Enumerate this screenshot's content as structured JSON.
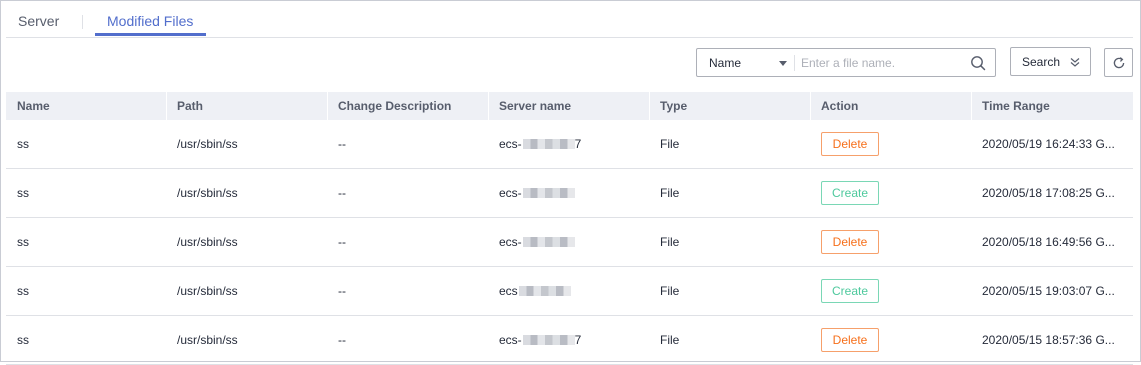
{
  "tabs": [
    {
      "label": "Server",
      "active": false
    },
    {
      "label": "Modified Files",
      "active": true
    }
  ],
  "toolbar": {
    "filter_field": "Name",
    "filter_placeholder": "Enter a file name.",
    "search_label": "Search",
    "icons": {
      "search": "search-icon",
      "expand": "double-chevron-down-icon",
      "refresh": "refresh-icon"
    }
  },
  "table": {
    "columns": [
      "Name",
      "Path",
      "Change Description",
      "Server name",
      "Type",
      "Action",
      "Time Range"
    ],
    "rows": [
      {
        "name": "ss",
        "path": "/usr/sbin/ss",
        "change": "--",
        "server_prefix": "ecs-",
        "server_suffix": "7",
        "type": "File",
        "action": "Delete",
        "action_kind": "delete",
        "time": "2020/05/19 16:24:33 G..."
      },
      {
        "name": "ss",
        "path": "/usr/sbin/ss",
        "change": "--",
        "server_prefix": "ecs-",
        "server_suffix": "",
        "type": "File",
        "action": "Create",
        "action_kind": "create",
        "time": "2020/05/18 17:08:25 G..."
      },
      {
        "name": "ss",
        "path": "/usr/sbin/ss",
        "change": "--",
        "server_prefix": "ecs-",
        "server_suffix": "",
        "type": "File",
        "action": "Delete",
        "action_kind": "delete",
        "time": "2020/05/18 16:49:56 G..."
      },
      {
        "name": "ss",
        "path": "/usr/sbin/ss",
        "change": "--",
        "server_prefix": "ecs",
        "server_suffix": "",
        "type": "File",
        "action": "Create",
        "action_kind": "create",
        "time": "2020/05/15 19:03:07 G..."
      },
      {
        "name": "ss",
        "path": "/usr/sbin/ss",
        "change": "--",
        "server_prefix": "ecs-",
        "server_suffix": "7",
        "type": "File",
        "action": "Delete",
        "action_kind": "delete",
        "time": "2020/05/15 18:57:36 G..."
      }
    ]
  },
  "colors": {
    "accent": "#526ecc",
    "delete": "#f66f1a",
    "create": "#4ec99d",
    "header_bg": "#eef0f5"
  }
}
